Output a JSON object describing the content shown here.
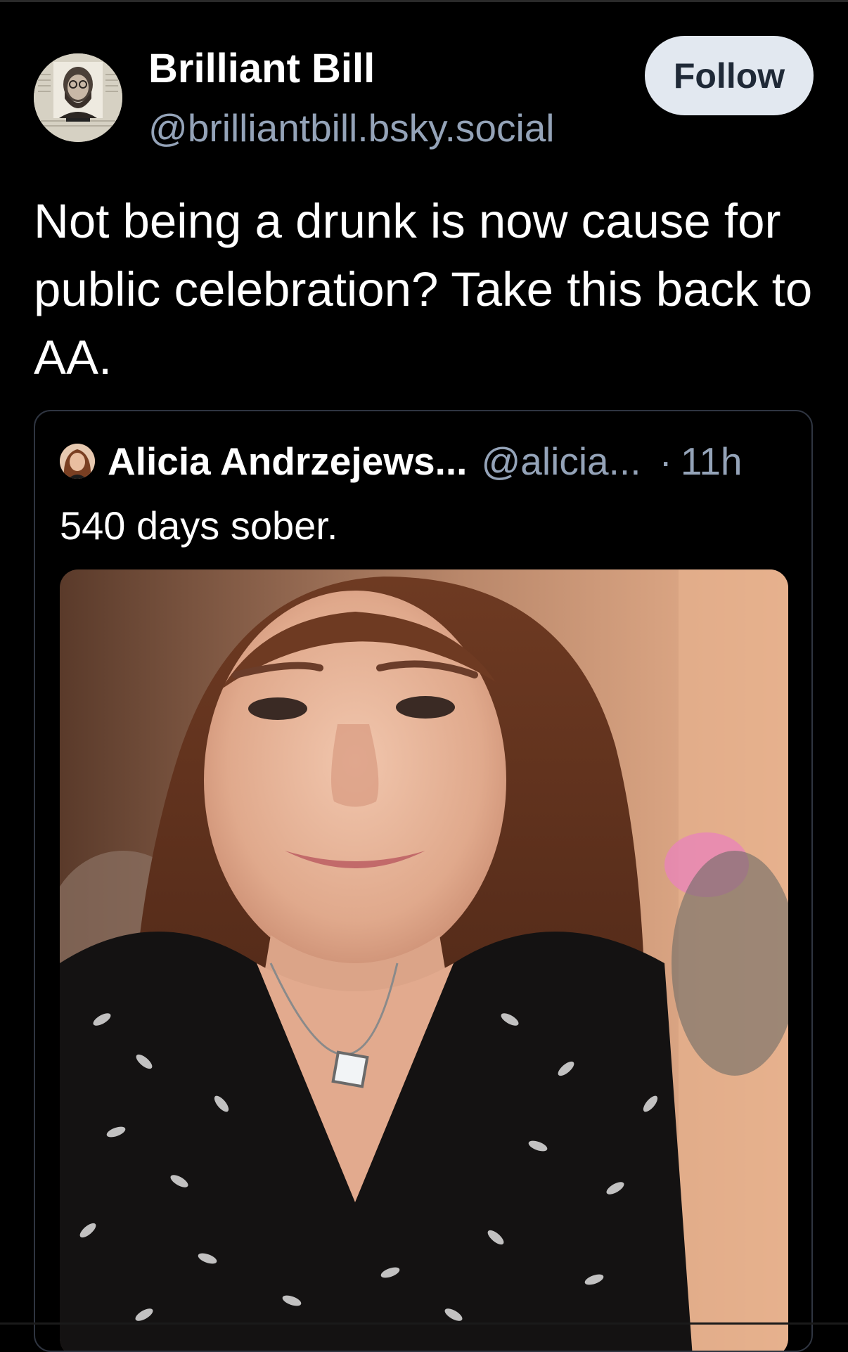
{
  "author": {
    "display_name": "Brilliant Bill",
    "handle": "@brilliantbill.bsky.social",
    "avatar_icon": "newspaper-clipping-avatar"
  },
  "follow_label": "Follow",
  "post_text": "Not being a drunk is now cause for public celebration? Take this back to AA.",
  "quoted_post": {
    "author_name": "Alicia Andrzejews...",
    "author_handle": "@alicia...",
    "separator": "·",
    "time": "11h",
    "text": "540 days sober.",
    "image_icon": "selfie-photo"
  },
  "colors": {
    "background": "#000000",
    "text": "#ffffff",
    "muted_text": "#94a3b8",
    "follow_button_bg": "#e2e8f0",
    "card_border": "#2f3541"
  }
}
